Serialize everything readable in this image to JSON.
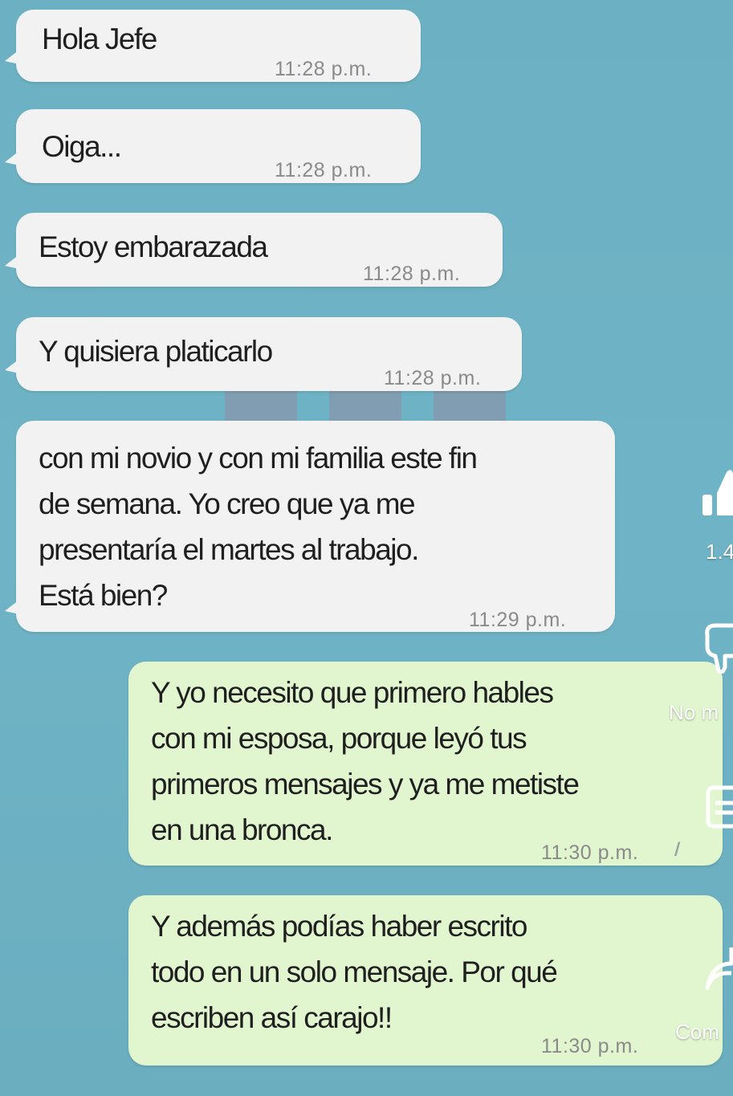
{
  "conversation": {
    "messages": [
      {
        "direction": "incoming",
        "text": "Hola Jefe",
        "time": "11:28 p.m."
      },
      {
        "direction": "incoming",
        "text": "Oiga...",
        "time": "11:28 p.m."
      },
      {
        "direction": "incoming",
        "text": "Estoy embarazada",
        "time": "11:28 p.m."
      },
      {
        "direction": "incoming",
        "text": "Y quisiera platicarlo",
        "time": "11:28 p.m."
      },
      {
        "direction": "incoming",
        "text": "con mi novio y con mi familia este fin\nde semana. Yo creo que ya me\npresentaría el martes al trabajo.\nEstá bien?",
        "time": "11:29 p.m."
      },
      {
        "direction": "outgoing",
        "text": "Y yo necesito que primero hables\ncon mi esposa, porque leyó tus\nprimeros mensajes y ya me metiste\nen una bronca.",
        "time": "11:30 p.m.",
        "ticks": "//"
      },
      {
        "direction": "outgoing",
        "text": "Y además podías haber escrito\ntodo en un solo mensaje. Por qué\nescriben así carajo!!",
        "time": "11:30 p.m."
      }
    ]
  },
  "overlay": {
    "like_count": "1.4",
    "dislike_label": "No m",
    "comments_label": "Com",
    "icons": [
      "thumbs-up-icon",
      "thumbs-down-icon",
      "comments-icon",
      "share-icon"
    ]
  },
  "colors": {
    "background": "#6fb2c4",
    "incoming_bubble": "#f2f2f2",
    "outgoing_bubble": "#e1f5cf",
    "timestamp": "#8a8a8a"
  }
}
